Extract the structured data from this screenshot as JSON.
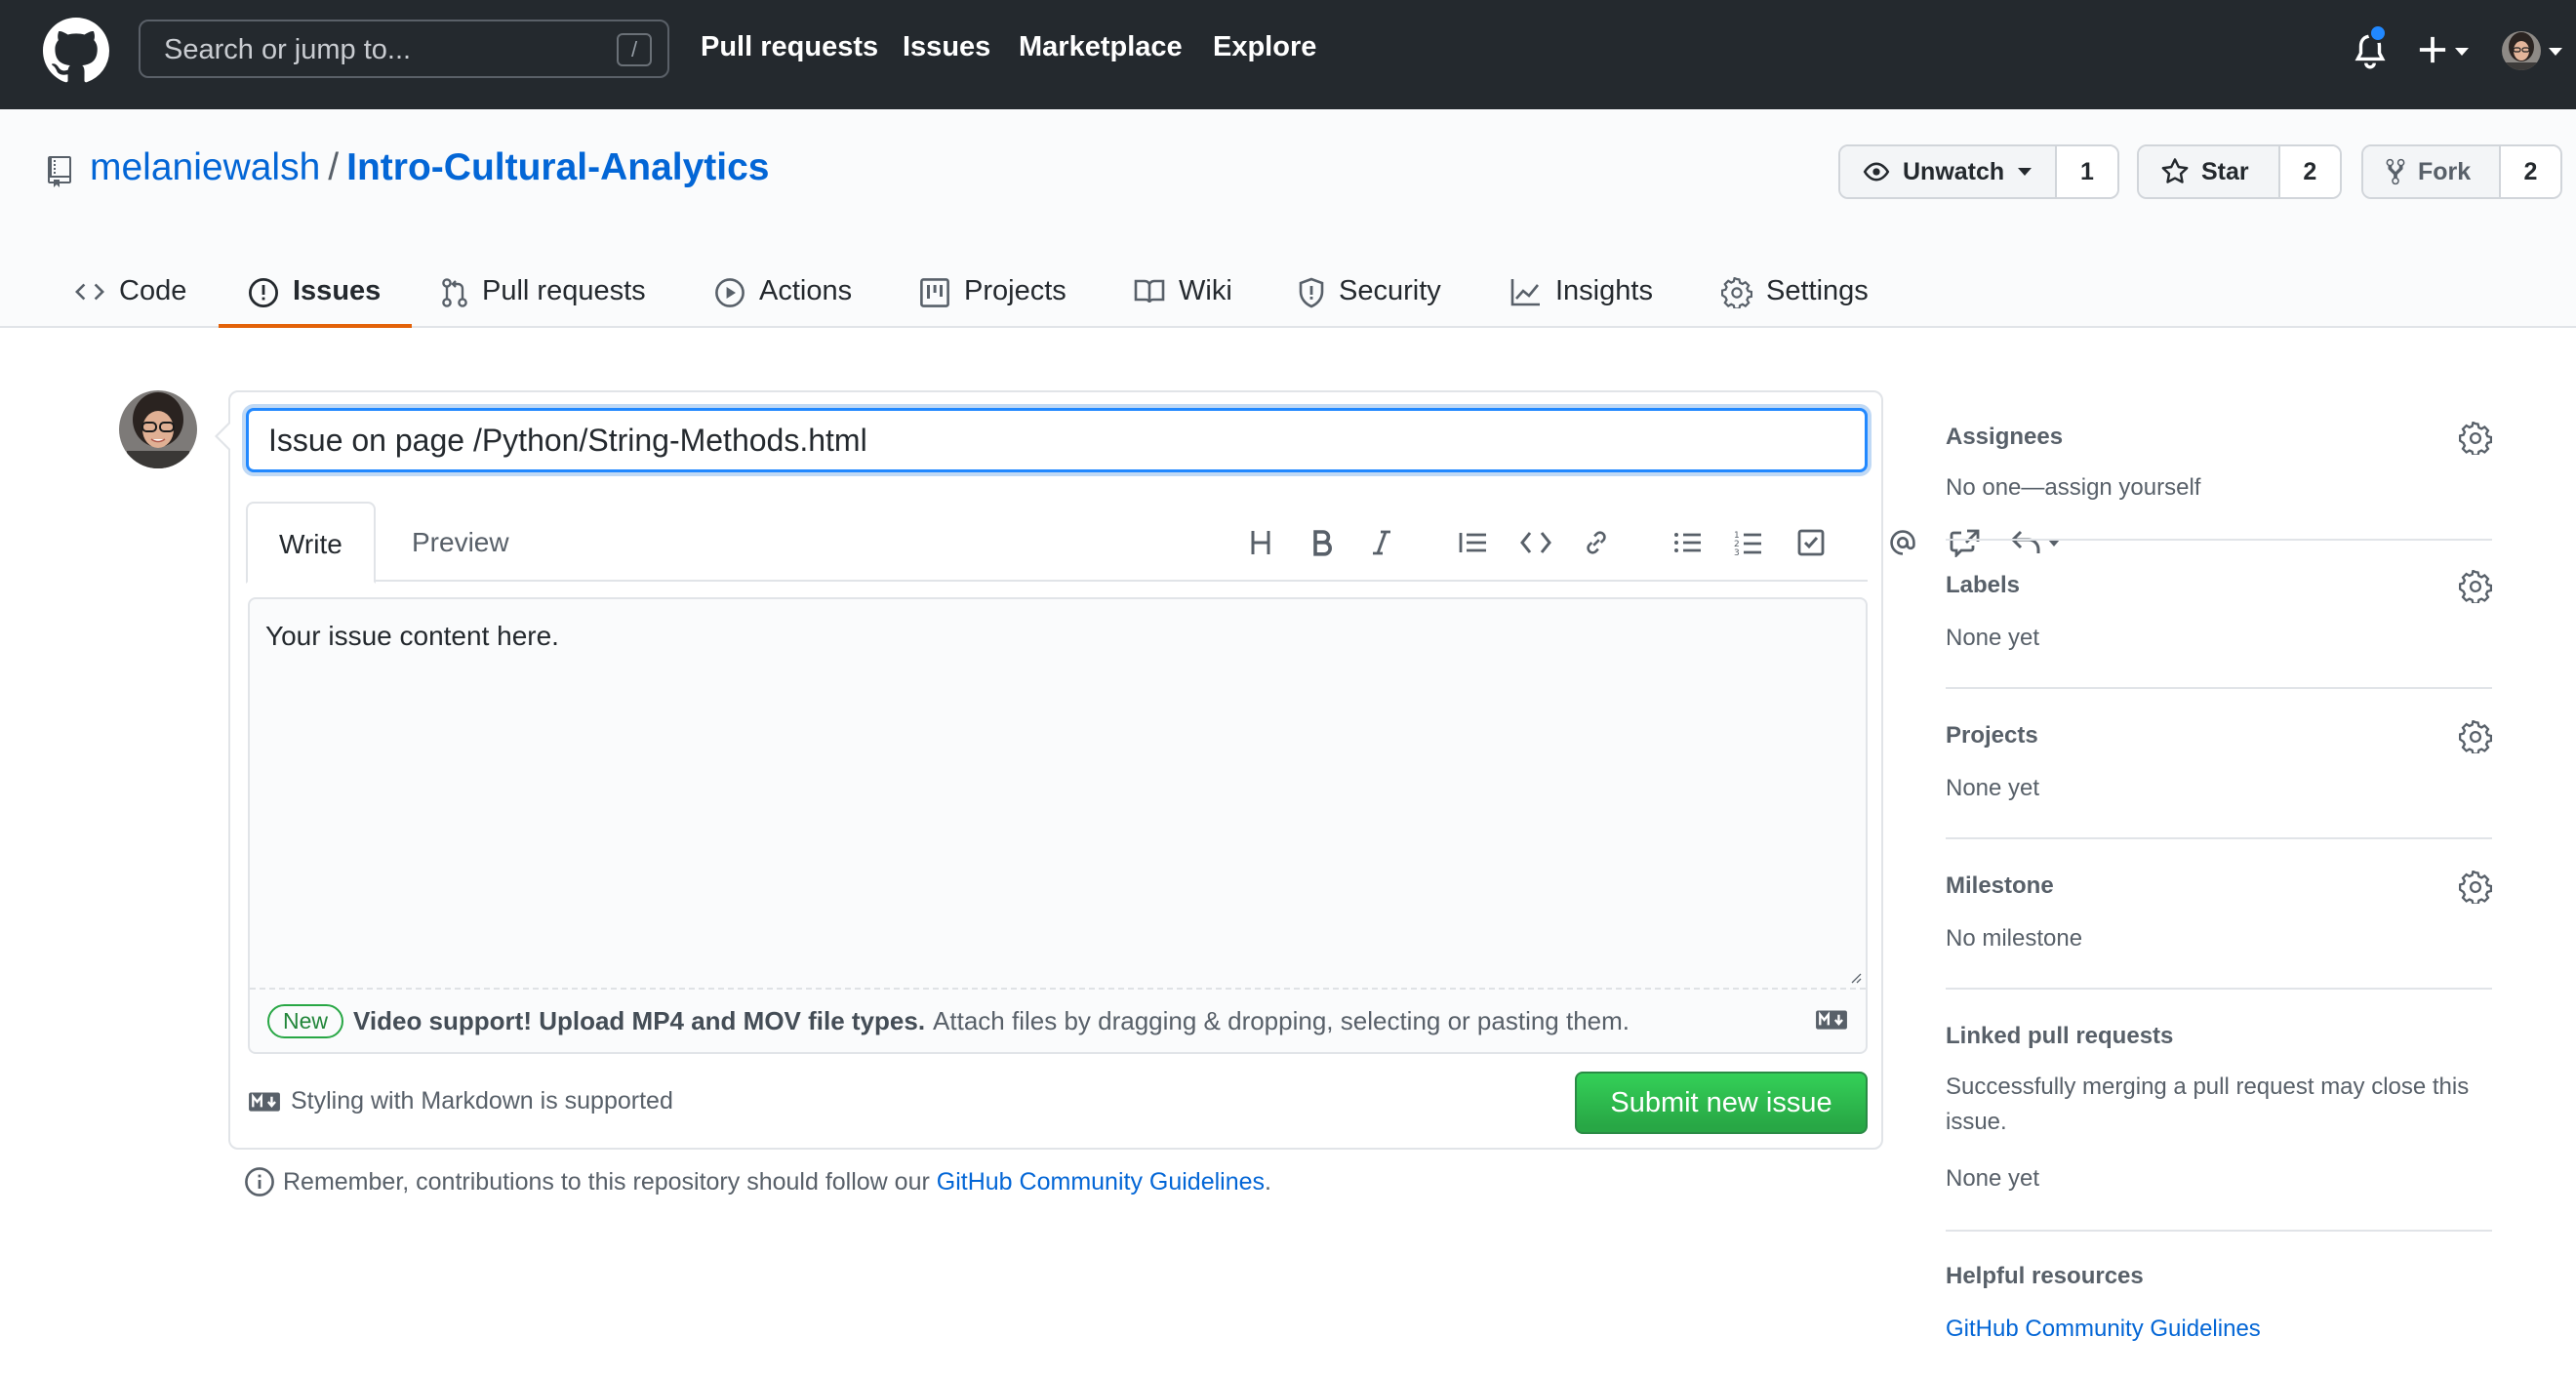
{
  "header": {
    "search_placeholder": "Search or jump to...",
    "search_shortcut": "/",
    "nav": [
      "Pull requests",
      "Issues",
      "Marketplace",
      "Explore"
    ]
  },
  "repo": {
    "owner": "melaniewalsh",
    "separator": "/",
    "name": "Intro-Cultural-Analytics",
    "watch_label": "Unwatch",
    "watch_count": "1",
    "star_label": "Star",
    "star_count": "2",
    "fork_label": "Fork",
    "fork_count": "2"
  },
  "tabs": [
    {
      "label": "Code",
      "icon": "code-icon"
    },
    {
      "label": "Issues",
      "icon": "issue-icon",
      "selected": true
    },
    {
      "label": "Pull requests",
      "icon": "pull-request-icon"
    },
    {
      "label": "Actions",
      "icon": "play-icon"
    },
    {
      "label": "Projects",
      "icon": "project-icon"
    },
    {
      "label": "Wiki",
      "icon": "book-icon"
    },
    {
      "label": "Security",
      "icon": "shield-icon"
    },
    {
      "label": "Insights",
      "icon": "graph-icon"
    },
    {
      "label": "Settings",
      "icon": "gear-icon"
    }
  ],
  "issue_form": {
    "title_value": "Issue on page /Python/String-Methods.html",
    "write_tab": "Write",
    "preview_tab": "Preview",
    "body_value": "Your issue content here.",
    "new_badge": "New",
    "upload_strong": "Video support! Upload MP4 and MOV file types.",
    "upload_text": "Attach files by dragging & dropping, selecting or pasting them.",
    "markdown_note": "Styling with Markdown is supported",
    "submit_label": "Submit new issue"
  },
  "remember": {
    "text": "Remember, contributions to this repository should follow our",
    "link": "GitHub Community Guidelines",
    "end": "."
  },
  "sidebar": {
    "assignees": {
      "heading": "Assignees",
      "value": "No one—assign yourself"
    },
    "labels": {
      "heading": "Labels",
      "value": "None yet"
    },
    "projects": {
      "heading": "Projects",
      "value": "None yet"
    },
    "milestone": {
      "heading": "Milestone",
      "value": "No milestone"
    },
    "linked_prs": {
      "heading": "Linked pull requests",
      "text": "Successfully merging a pull request may close this issue.",
      "value": "None yet"
    },
    "helpful": {
      "heading": "Helpful resources",
      "link": "GitHub Community Guidelines"
    }
  },
  "colors": {
    "header_bg": "#24292e",
    "link": "#0366d6",
    "submit_green": "#2ea44f",
    "tab_underline": "#e36209"
  }
}
